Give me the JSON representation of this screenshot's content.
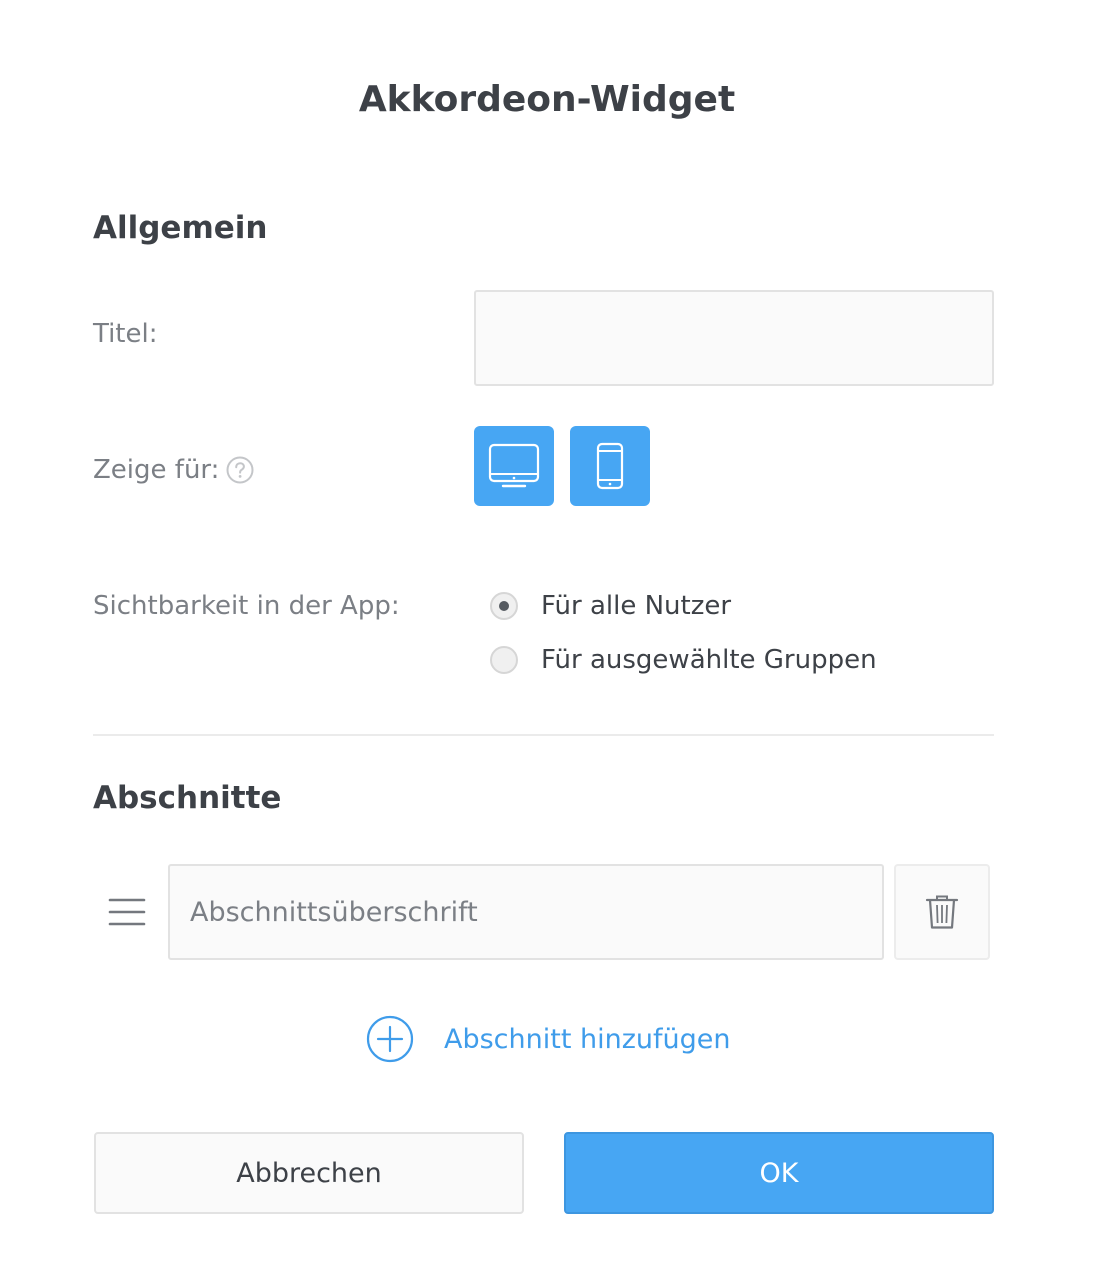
{
  "dialog": {
    "title": "Akkordeon-Widget"
  },
  "general": {
    "heading": "Allgemein",
    "title_field": {
      "label": "Titel:",
      "value": "",
      "placeholder": ""
    },
    "show_for": {
      "label": "Zeige für:",
      "help_icon": "question-circle-icon",
      "devices": [
        {
          "icon": "desktop-icon",
          "selected": true
        },
        {
          "icon": "mobile-phone-icon",
          "selected": true
        }
      ]
    },
    "visibility": {
      "label": "Sichtbarkeit in der App:",
      "options": [
        {
          "label": "Für alle Nutzer",
          "checked": true
        },
        {
          "label": "Für ausgewählte Gruppen",
          "checked": false
        }
      ]
    }
  },
  "sections": {
    "heading": "Abschnitte",
    "items": [
      {
        "heading_value": "",
        "placeholder": "Abschnittsüberschrift"
      }
    ],
    "drag_icon": "drag-handle-icon",
    "delete_icon": "trash-icon",
    "add_icon": "plus-circle-icon",
    "add_label": "Abschnitt hinzufügen"
  },
  "footer": {
    "cancel_label": "Abbrechen",
    "ok_label": "OK"
  },
  "colors": {
    "accent": "#47a6f3",
    "link": "#3f9cea",
    "text": "#3d4147",
    "muted": "#7b7f85"
  }
}
